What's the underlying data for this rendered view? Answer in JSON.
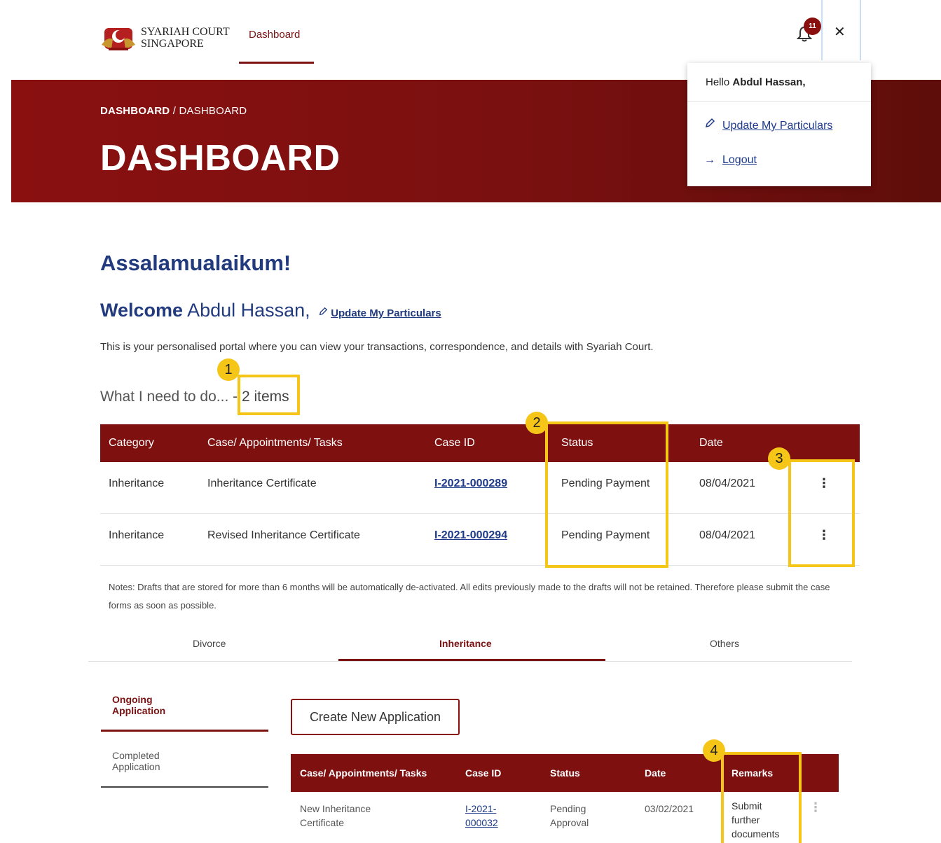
{
  "header": {
    "logo_line1": "SYARIAH COURT",
    "logo_line2": "SINGAPORE",
    "nav_dashboard": "Dashboard",
    "notification_count": "11",
    "close_glyph": "✕"
  },
  "user_menu": {
    "hello": "Hello",
    "name": "Abdul Hassan,",
    "update_particulars": "Update My Particulars",
    "logout": "Logout"
  },
  "banner": {
    "breadcrumb_root": "DASHBOARD",
    "breadcrumb_sep": "/",
    "breadcrumb_current": "DASHBOARD",
    "title": "DASHBOARD"
  },
  "main": {
    "greeting": "Assalamualaikum!",
    "welcome_prefix": "Welcome",
    "welcome_name": "Abdul Hassan,",
    "update_link": "Update My Particulars",
    "intro": "This is your personalised portal where you can view your transactions, correspondence, and details with Syariah Court.",
    "todo_label": "What I need to do... -",
    "todo_count": "2 items"
  },
  "todo_table": {
    "headers": [
      "Category",
      "Case/ Appointments/ Tasks",
      "Case ID",
      "Status",
      "Date"
    ],
    "rows": [
      {
        "category": "Inheritance",
        "task": "Inheritance Certificate",
        "case_id": "I-2021-000289",
        "status": "Pending Payment",
        "date": "08/04/2021"
      },
      {
        "category": "Inheritance",
        "task": "Revised Inheritance Certificate",
        "case_id": "I-2021-000294",
        "status": "Pending Payment",
        "date": "08/04/2021"
      }
    ],
    "kebab": "⋮"
  },
  "notes": "Notes: Drafts that are stored for more than 6 months will be automatically de-activated. All edits previously made to the drafts will not be retained. Therefore please submit the case forms as soon as possible.",
  "tabs": [
    "Divorce",
    "Inheritance",
    "Others"
  ],
  "side_nav": {
    "ongoing": "Ongoing Application",
    "completed": "Completed Application"
  },
  "create_button": "Create New Application",
  "app_table": {
    "headers": [
      "Case/ Appointments/ Tasks",
      "Case ID",
      "Status",
      "Date",
      "Remarks"
    ],
    "row": {
      "task_line1": "New Inheritance",
      "task_line2": "Certificate",
      "case_id_line1": "I-2021-",
      "case_id_line2": "000032",
      "status_line1": "Pending",
      "status_line2": "Approval",
      "date": "03/02/2021",
      "remarks_line1": "Submit",
      "remarks_line2": "further",
      "remarks_line3": "documents"
    },
    "kebab": "⋮"
  },
  "annotations": [
    "1",
    "2",
    "3",
    "4"
  ],
  "colors": {
    "brand_maroon": "#7e1010",
    "link_blue": "#1d3a8a",
    "highlight_yellow": "#f5c518"
  }
}
